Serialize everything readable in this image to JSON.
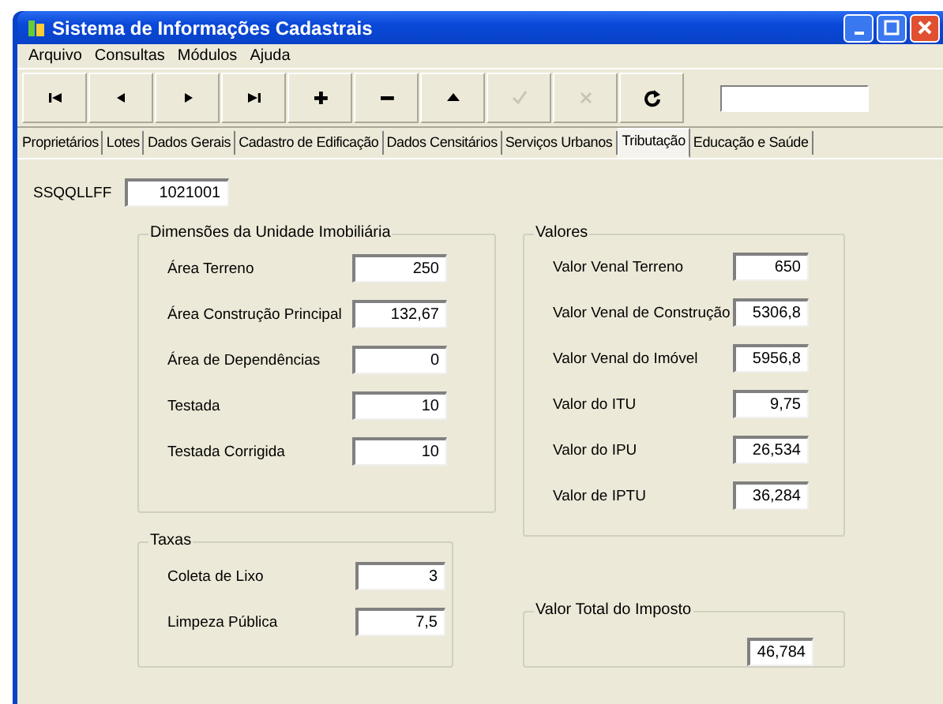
{
  "window": {
    "title": "Sistema de Informações Cadastrais",
    "controls": [
      {
        "kind": "minimize"
      },
      {
        "kind": "maximize"
      },
      {
        "kind": "close"
      }
    ]
  },
  "menu": [
    {
      "label": "Arquivo"
    },
    {
      "label": "Consultas"
    },
    {
      "label": "Módulos"
    },
    {
      "label": "Ajuda"
    }
  ],
  "toolbar": {
    "buttons": [
      {
        "kind": "first",
        "disabled": false
      },
      {
        "kind": "prev",
        "disabled": false
      },
      {
        "kind": "next",
        "disabled": false
      },
      {
        "kind": "last",
        "disabled": false
      },
      {
        "kind": "add",
        "disabled": false
      },
      {
        "kind": "remove",
        "disabled": false
      },
      {
        "kind": "up",
        "disabled": false
      },
      {
        "kind": "confirm",
        "disabled": true
      },
      {
        "kind": "cancel",
        "disabled": true
      },
      {
        "kind": "refresh",
        "disabled": false
      }
    ],
    "search_field": true
  },
  "tabs": [
    {
      "label": "Proprietários",
      "selected": false
    },
    {
      "label": "Lotes",
      "selected": false
    },
    {
      "label": "Dados Gerais",
      "selected": false
    },
    {
      "label": "Cadastro de Edificação",
      "selected": false
    },
    {
      "label": "Dados Censitários",
      "selected": false
    },
    {
      "label": "Serviços Urbanos",
      "selected": false
    },
    {
      "label": "Tributação",
      "selected": true
    },
    {
      "label": "Educação e Saúde",
      "selected": false
    }
  ],
  "code": {
    "label": "SSQQLLFF",
    "value": "1021001"
  },
  "dimensoes": {
    "title": "Dimensões da Unidade Imobiliária",
    "fields": [
      {
        "label": "Área Terreno",
        "value": "250"
      },
      {
        "label": "Área Construção Principal",
        "value": "132,67"
      },
      {
        "label": "Área de Dependências",
        "value": "0"
      },
      {
        "label": "Testada",
        "value": "10"
      },
      {
        "label": "Testada Corrigida",
        "value": "10"
      }
    ]
  },
  "valores": {
    "title": "Valores",
    "fields": [
      {
        "label": "Valor Venal Terreno",
        "value": "650"
      },
      {
        "label": "Valor Venal de Construção",
        "value": "5306,8"
      },
      {
        "label": "Valor Venal do Imóvel",
        "value": "5956,8"
      },
      {
        "label": "Valor do ITU",
        "value": "9,75"
      },
      {
        "label": "Valor do IPU",
        "value": "26,534"
      },
      {
        "label": "Valor de IPTU",
        "value": "36,284"
      }
    ]
  },
  "taxas": {
    "title": "Taxas",
    "fields": [
      {
        "label": "Coleta de Lixo",
        "value": "3"
      },
      {
        "label": "Limpeza Pública",
        "value": "7,5"
      }
    ]
  },
  "total": {
    "title": "Valor Total do Imposto",
    "value": "46,784"
  }
}
